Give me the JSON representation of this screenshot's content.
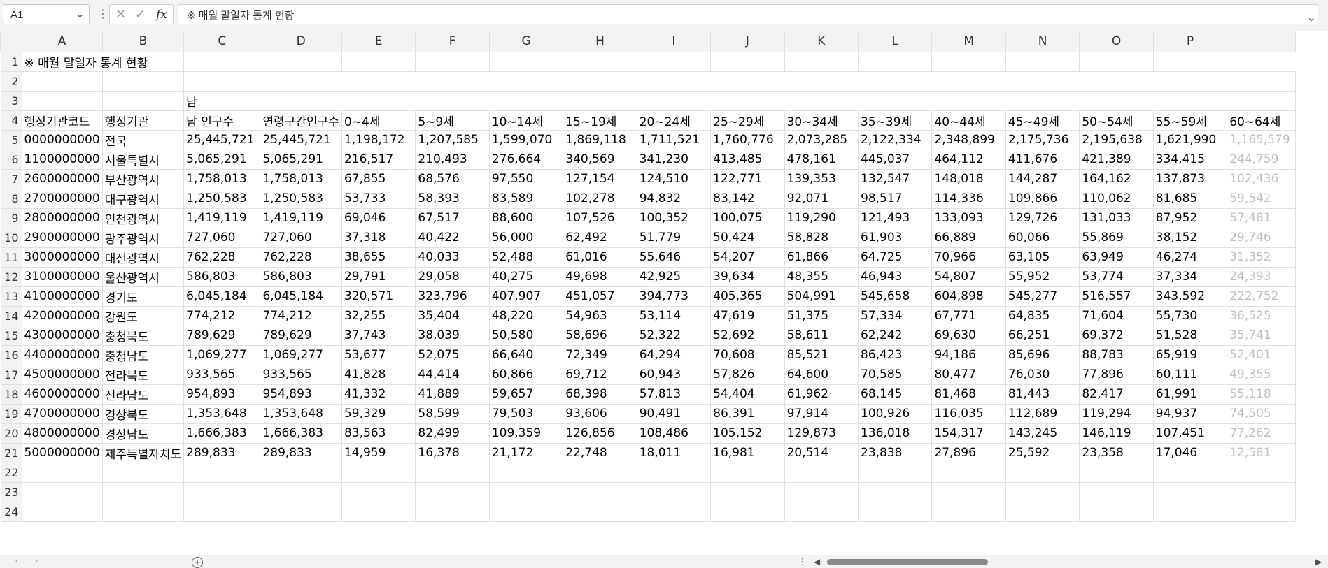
{
  "formula_bar": {
    "cell_ref": "A1",
    "formula": "※ 매월 말일자 통계 현황"
  },
  "columns": [
    "A",
    "B",
    "C",
    "D",
    "E",
    "F",
    "G",
    "H",
    "I",
    "J",
    "K",
    "L",
    "M",
    "N",
    "O",
    "P"
  ],
  "sheet": {
    "title": "※ 매월 말일자 통계 현황",
    "gender_label": "남",
    "headers": [
      "행정기관코드",
      "행정기관",
      "남 인구수",
      "연령구간인구수",
      "0~4세",
      "5~9세",
      "10~14세",
      "15~19세",
      "20~24세",
      "25~29세",
      "30~34세",
      "35~39세",
      "40~44세",
      "45~49세",
      "50~54세",
      "55~59세",
      "60~64세"
    ],
    "rows": [
      [
        "0000000000",
        "전국",
        "25,445,721",
        "25,445,721",
        "1,198,172",
        "1,207,585",
        "1,599,070",
        "1,869,118",
        "1,711,521",
        "1,760,776",
        "2,073,285",
        "2,122,334",
        "2,348,899",
        "2,175,736",
        "2,195,638",
        "1,621,990",
        "1,165,579"
      ],
      [
        "1100000000",
        "서울특별시",
        "5,065,291",
        "5,065,291",
        "216,517",
        "210,493",
        "276,664",
        "340,569",
        "341,230",
        "413,485",
        "478,161",
        "445,037",
        "464,112",
        "411,676",
        "421,389",
        "334,415",
        "244,759"
      ],
      [
        "2600000000",
        "부산광역시",
        "1,758,013",
        "1,758,013",
        "67,855",
        "68,576",
        "97,550",
        "127,154",
        "124,510",
        "122,771",
        "139,353",
        "132,547",
        "148,018",
        "144,287",
        "164,162",
        "137,873",
        "102,436"
      ],
      [
        "2700000000",
        "대구광역시",
        "1,250,583",
        "1,250,583",
        "53,733",
        "58,393",
        "83,589",
        "102,278",
        "94,832",
        "83,142",
        "92,071",
        "98,517",
        "114,336",
        "109,866",
        "110,062",
        "81,685",
        "59,542"
      ],
      [
        "2800000000",
        "인천광역시",
        "1,419,119",
        "1,419,119",
        "69,046",
        "67,517",
        "88,600",
        "107,526",
        "100,352",
        "100,075",
        "119,290",
        "121,493",
        "133,093",
        "129,726",
        "131,033",
        "87,952",
        "57,481"
      ],
      [
        "2900000000",
        "광주광역시",
        "727,060",
        "727,060",
        "37,318",
        "40,422",
        "56,000",
        "62,492",
        "51,779",
        "50,424",
        "58,828",
        "61,903",
        "66,889",
        "60,066",
        "55,869",
        "38,152",
        "29,746"
      ],
      [
        "3000000000",
        "대전광역시",
        "762,228",
        "762,228",
        "38,655",
        "40,033",
        "52,488",
        "61,016",
        "55,646",
        "54,207",
        "61,866",
        "64,725",
        "70,966",
        "63,105",
        "63,949",
        "46,274",
        "31,352"
      ],
      [
        "3100000000",
        "울산광역시",
        "586,803",
        "586,803",
        "29,791",
        "29,058",
        "40,275",
        "49,698",
        "42,925",
        "39,634",
        "48,355",
        "46,943",
        "54,807",
        "55,952",
        "53,774",
        "37,334",
        "24,393"
      ],
      [
        "4100000000",
        "경기도",
        "6,045,184",
        "6,045,184",
        "320,571",
        "323,796",
        "407,907",
        "451,057",
        "394,773",
        "405,365",
        "504,991",
        "545,658",
        "604,898",
        "545,277",
        "516,557",
        "343,592",
        "222,752"
      ],
      [
        "4200000000",
        "강원도",
        "774,212",
        "774,212",
        "32,255",
        "35,404",
        "48,220",
        "54,963",
        "53,114",
        "47,619",
        "51,375",
        "57,334",
        "67,771",
        "64,835",
        "71,604",
        "55,730",
        "36,525"
      ],
      [
        "4300000000",
        "충청북도",
        "789,629",
        "789,629",
        "37,743",
        "38,039",
        "50,580",
        "58,696",
        "52,322",
        "52,692",
        "58,611",
        "62,242",
        "69,630",
        "66,251",
        "69,372",
        "51,528",
        "35,741"
      ],
      [
        "4400000000",
        "충청남도",
        "1,069,277",
        "1,069,277",
        "53,677",
        "52,075",
        "66,640",
        "72,349",
        "64,294",
        "70,608",
        "85,521",
        "86,423",
        "94,186",
        "85,696",
        "88,783",
        "65,919",
        "52,401"
      ],
      [
        "4500000000",
        "전라북도",
        "933,565",
        "933,565",
        "41,828",
        "44,414",
        "60,866",
        "69,712",
        "60,943",
        "57,826",
        "64,600",
        "70,585",
        "80,477",
        "76,030",
        "77,896",
        "60,111",
        "49,355"
      ],
      [
        "4600000000",
        "전라남도",
        "954,893",
        "954,893",
        "41,332",
        "41,889",
        "59,657",
        "68,398",
        "57,813",
        "54,404",
        "61,962",
        "68,145",
        "81,468",
        "81,443",
        "82,417",
        "61,991",
        "55,118"
      ],
      [
        "4700000000",
        "경상북도",
        "1,353,648",
        "1,353,648",
        "59,329",
        "58,599",
        "79,503",
        "93,606",
        "90,491",
        "86,391",
        "97,914",
        "100,926",
        "116,035",
        "112,689",
        "119,294",
        "94,937",
        "74,505"
      ],
      [
        "4800000000",
        "경상남도",
        "1,666,383",
        "1,666,383",
        "83,563",
        "82,499",
        "109,359",
        "126,856",
        "108,486",
        "105,152",
        "129,873",
        "136,018",
        "154,317",
        "143,245",
        "146,119",
        "107,451",
        "77,262"
      ],
      [
        "5000000000",
        "제주특별자치도",
        "289,833",
        "289,833",
        "14,959",
        "16,378",
        "21,172",
        "22,748",
        "18,011",
        "16,981",
        "20,514",
        "23,838",
        "27,896",
        "25,592",
        "23,358",
        "17,046",
        "12,581"
      ]
    ]
  },
  "icons": {
    "name_box_dropdown": "chevron-down-icon",
    "cancel": "x-icon",
    "confirm": "check-icon",
    "function": "fx-icon",
    "add_sheet": "plus-circle-icon"
  }
}
